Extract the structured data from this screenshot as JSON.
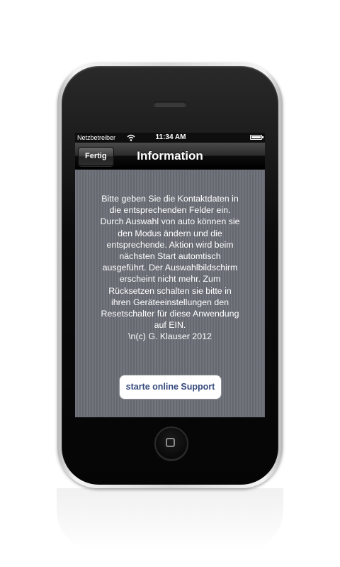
{
  "statusbar": {
    "carrier": "Netzbetreiber",
    "time": "11:34 AM"
  },
  "navbar": {
    "back_label": "Fertig",
    "title": "Information"
  },
  "content": {
    "info_text": "Bitte geben Sie die Kontaktdaten in\ndie entsprechenden Felder ein.\nDurch Auswahl von auto können sie\nden Modus ändern und die\nentsprechende.  Aktion wird beim\nnächsten Start automtisch\nausgeführt. Der Auswahlbildschirm\nerscheint nicht mehr. Zum\nRücksetzen schalten sie bitte in\nihren Geräteeinstellungen den\nResetschalter für diese Anwendung\nauf EIN.\n\\n(c) G. Klauser 2012",
    "support_button_label": "starte online Support"
  },
  "icons": {
    "wifi": "wifi-icon",
    "battery": "battery-icon",
    "home": "home-button-icon"
  },
  "colors": {
    "background_texture": "#6b6e76",
    "button_text": "#364a7e",
    "navbar": "#000000"
  }
}
